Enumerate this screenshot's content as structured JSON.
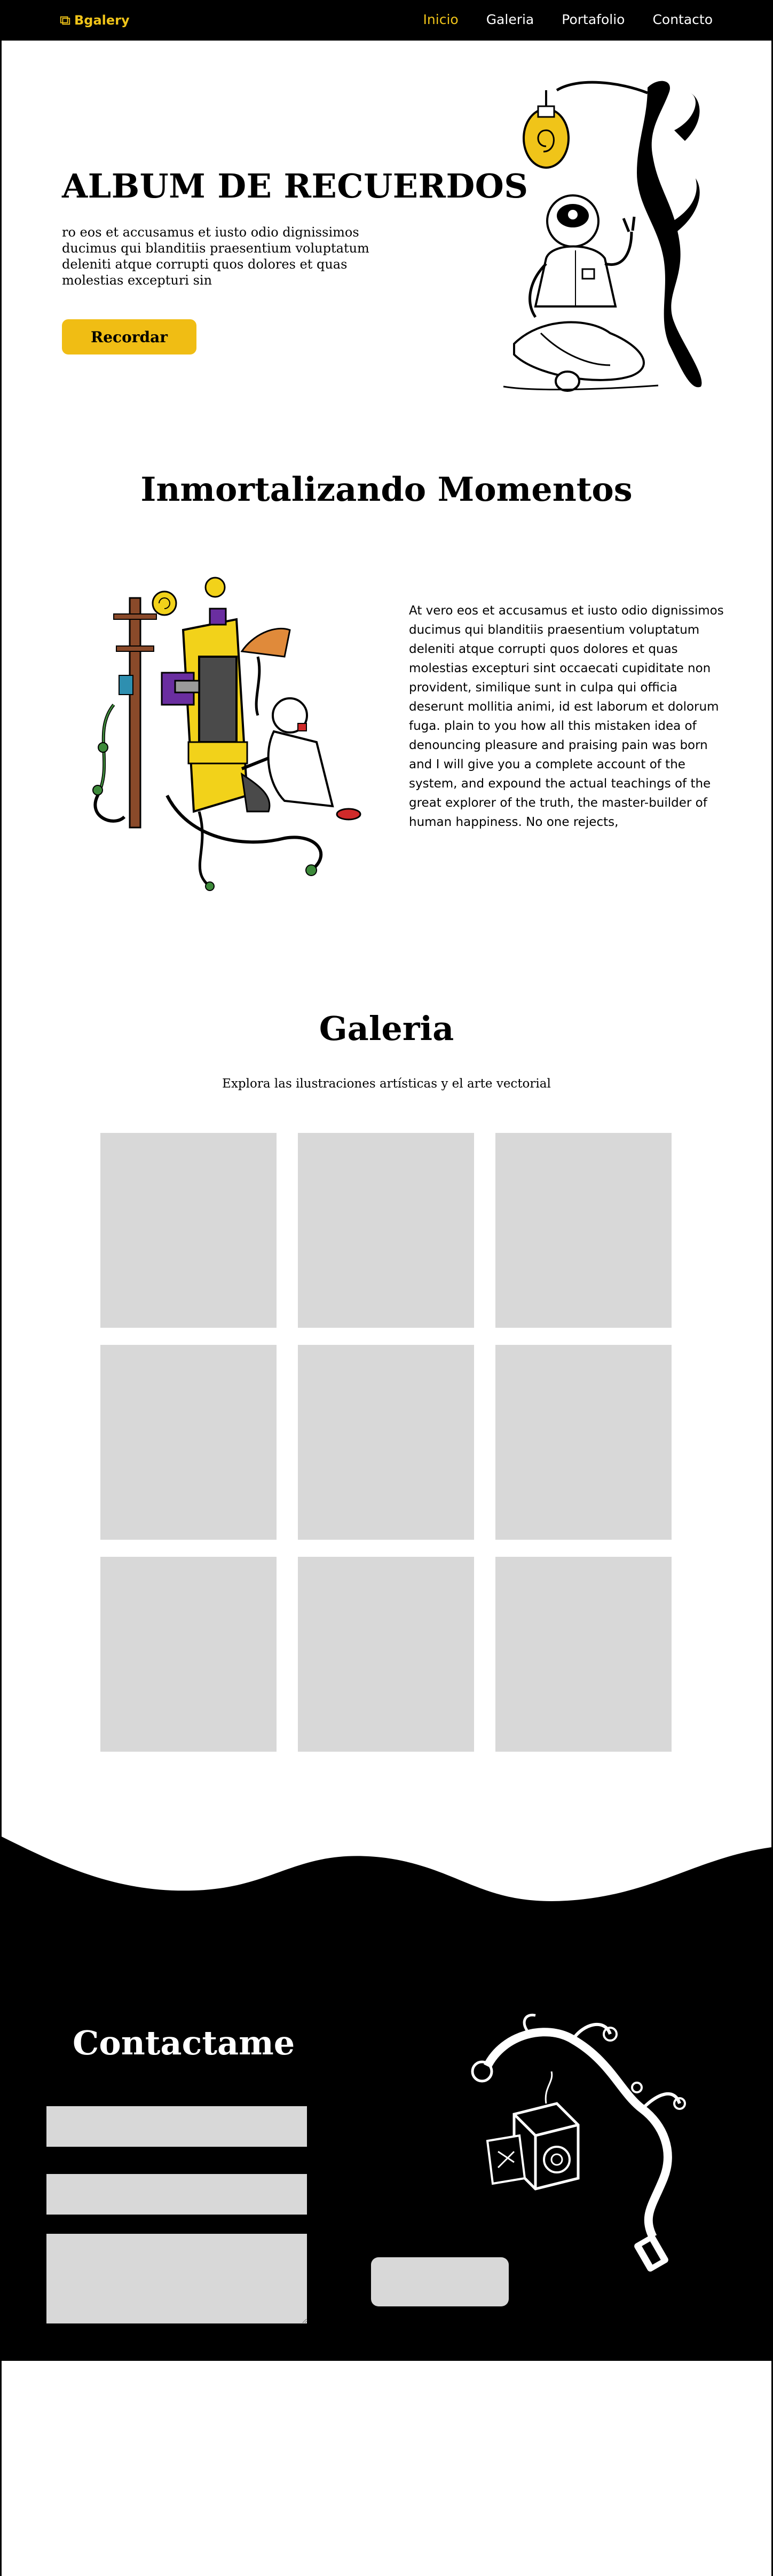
{
  "navbar": {
    "brand": "Bgalery",
    "links": [
      {
        "label": "Inicio",
        "active": true
      },
      {
        "label": "Galeria",
        "active": false
      },
      {
        "label": "Portafolio",
        "active": false
      },
      {
        "label": "Contacto",
        "active": false
      }
    ]
  },
  "hero": {
    "title": "ALBUM DE RECUERDOS",
    "text": "ro eos et accusamus et iusto odio dignissimos ducimus qui blanditiis praesentium voluptatum deleniti atque corrupti quos dolores et quas molestias excepturi sin",
    "button_label": "Recordar"
  },
  "section2": {
    "title": "Inmortalizando Momentos",
    "text": "At vero eos et accusamus et iusto odio dignissimos ducimus qui blanditiis praesentium voluptatum deleniti atque corrupti quos dolores et quas molestias excepturi sint occaecati cupiditate non provident, similique sunt in culpa qui officia deserunt mollitia animi, id est laborum et dolorum fuga. plain to you how all this mistaken idea of denouncing pleasure and praising pain was born and I will give you a complete account of the system, and expound the actual teachings of the great explorer of the truth, the master-builder of human happiness. No one rejects,"
  },
  "gallery": {
    "title": "Galeria",
    "subtitle": "Explora las ilustraciones artísticas y el arte vectorial",
    "item_count": 9
  },
  "contact": {
    "title": "Contactame"
  },
  "colors": {
    "accent": "#f0c419",
    "button": "#f0bd14",
    "placeholder": "#d8d8d8",
    "dark": "#000000"
  }
}
